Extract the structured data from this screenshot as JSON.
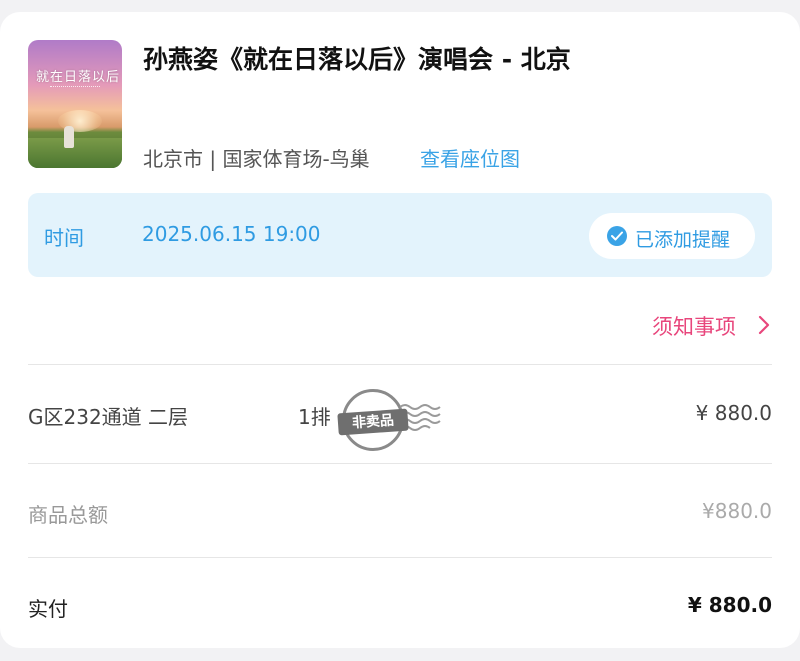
{
  "event": {
    "title": "孙燕姿《就在日落以后》演唱会 - 北京",
    "poster_title": "就在日落以后",
    "venue": "北京市 | 国家体育场-鸟巢",
    "seat_map_link": "查看座位图"
  },
  "time": {
    "label": "时间",
    "value": "2025.06.15 19:00",
    "reminder_label": "已添加提醒",
    "reminder_icon": "check-circle-icon"
  },
  "notice": {
    "label": "须知事项",
    "icon": "chevron-right-icon"
  },
  "ticket": {
    "area": "G区232通道 二层",
    "row": "1排",
    "stamp": "非卖品",
    "price": "¥ 880.0"
  },
  "summary": {
    "subtotal_label": "商品总额",
    "subtotal_value": "¥880.0",
    "paid_label": "实付",
    "paid_value": "¥ 880.0"
  },
  "colors": {
    "accent_blue": "#3aa3e6",
    "accent_pink": "#e8467c",
    "time_box_bg": "#e3f3fc"
  }
}
